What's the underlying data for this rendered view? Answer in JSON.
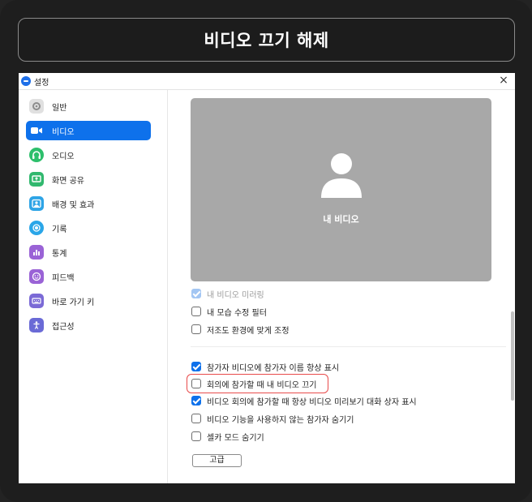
{
  "banner": {
    "title": "비디오 끄기 해제"
  },
  "window": {
    "title": "설정",
    "close_glyph": "×"
  },
  "sidebar": {
    "items": [
      {
        "label": "일반",
        "icon": "gear-icon",
        "color": "#d9d9d9",
        "active": false
      },
      {
        "label": "비디오",
        "icon": "camera-icon",
        "color": "#ffffff",
        "active": true
      },
      {
        "label": "오디오",
        "icon": "headphones-icon",
        "color": "#2dbf6b",
        "active": false
      },
      {
        "label": "화면 공유",
        "icon": "share-screen-icon",
        "color": "#31b86e",
        "active": false
      },
      {
        "label": "배경 및 효과",
        "icon": "background-icon",
        "color": "#2ea4e6",
        "active": false
      },
      {
        "label": "기록",
        "icon": "record-icon",
        "color": "#2aa6e8",
        "active": false
      },
      {
        "label": "통계",
        "icon": "statistics-icon",
        "color": "#9a63d6",
        "active": false
      },
      {
        "label": "피드백",
        "icon": "feedback-icon",
        "color": "#9a63d6",
        "active": false
      },
      {
        "label": "바로 가기 키",
        "icon": "keyboard-icon",
        "color": "#7b6ad6",
        "active": false
      },
      {
        "label": "접근성",
        "icon": "accessibility-icon",
        "color": "#6a6ad6",
        "active": false
      }
    ]
  },
  "preview": {
    "label": "내 비디오"
  },
  "options": {
    "group1": [
      {
        "label": "내 비디오 미러링",
        "state": "disabled-checked"
      },
      {
        "label": "내 모습 수정 필터",
        "state": "unchecked"
      },
      {
        "label": "저조도 환경에 맞게 조정",
        "state": "unchecked"
      }
    ],
    "group2": [
      {
        "label": "참가자 비디오에 참가자 이름 항상 표시",
        "state": "checked"
      },
      {
        "label": "회의에 참가할 때 내 비디오 끄기",
        "state": "unchecked"
      },
      {
        "label": "비디오 회의에 참가할 때 항상 비디오 미리보기 대화 상자 표시",
        "state": "checked"
      },
      {
        "label": "비디오 기능을 사용하지 않는 참가자 숨기기",
        "state": "unchecked"
      },
      {
        "label": "셀카 모드 숨기기",
        "state": "unchecked"
      }
    ]
  },
  "advanced_button": {
    "label": "고급"
  },
  "colors": {
    "accent": "#0e71eb",
    "highlight": "#e84b4b"
  }
}
